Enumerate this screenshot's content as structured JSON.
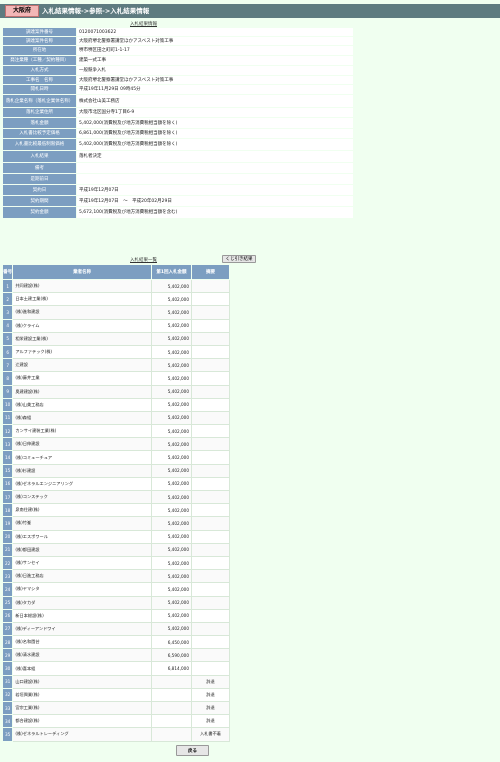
{
  "header": {
    "logo_text": "大阪府",
    "breadcrumb": "入札結果情報->参照->入札結果情報"
  },
  "detail": {
    "caption": "入札結果情報",
    "rows": [
      {
        "label": "調達案件番号",
        "value": "0120071003622"
      },
      {
        "label": "調達案件名称",
        "value": "大阪府堺北警察署講堂ほかアスベスト対策工事"
      },
      {
        "label": "所在地",
        "value": "堺市堺区田之町町1-1-17"
      },
      {
        "label": "発注業種（工種／契約種目）",
        "value": "建築一式工事"
      },
      {
        "label": "入札方式",
        "value": "一般競争入札"
      },
      {
        "label": "工事名　名称",
        "value": "大阪府堺北警察署講堂ほかアスベスト対策工事"
      },
      {
        "label": "開札日時",
        "value": "平成19年11月29日 09時45分"
      },
      {
        "label": "落札企業名称（落札企業体名称）",
        "value": "株式会社山美工務店"
      },
      {
        "label": "落札企業住所",
        "value": "大阪市北区国分寺1丁目6-9"
      },
      {
        "label": "落札金額",
        "value": "5,402,000(消費税及び地方消費税相当額を除く)"
      },
      {
        "label": "入札書比較予定価格",
        "value": "6,861,000(消費税及び地方消費税相当額を除く)"
      },
      {
        "label": "入札書比較最低制限価格",
        "value": "5,402,000(消費税及び地方消費税相当額を除く)"
      },
      {
        "label": "入札結果",
        "value": "落札者決定"
      },
      {
        "label": "備考",
        "value": ""
      },
      {
        "label": "是期前日",
        "value": ""
      },
      {
        "label": "契約日",
        "value": "平成19年12月07日"
      },
      {
        "label": "契約期間",
        "value": "平成19年12月07日　～　平成20年02月29日"
      },
      {
        "label": "契約金額",
        "value": "5,672,100(消費税及び地方消費税相当額を含む)"
      }
    ]
  },
  "results": {
    "caption": "入札結果一覧",
    "lottery_button": "くじ引き結果",
    "columns": [
      "番号",
      "業者名称",
      "第1回入札金額",
      "摘要"
    ],
    "rows": [
      {
        "no": "1",
        "name": "共同建設(株)",
        "amount": "5,402,000",
        "note": ""
      },
      {
        "no": "2",
        "name": "日本土建工業(株)",
        "amount": "5,402,000",
        "note": ""
      },
      {
        "no": "3",
        "name": "(株)進和建設",
        "amount": "5,402,000",
        "note": ""
      },
      {
        "no": "4",
        "name": "(株)クライム",
        "amount": "5,402,000",
        "note": ""
      },
      {
        "no": "5",
        "name": "相栄建設工業(株)",
        "amount": "5,402,000",
        "note": ""
      },
      {
        "no": "6",
        "name": "アルファテック(株)",
        "amount": "5,402,000",
        "note": ""
      },
      {
        "no": "7",
        "name": "辻建設",
        "amount": "5,402,000",
        "note": ""
      },
      {
        "no": "8",
        "name": "(株)藤井工業",
        "amount": "5,402,000",
        "note": ""
      },
      {
        "no": "9",
        "name": "奥建建設(株)",
        "amount": "5,402,000",
        "note": ""
      },
      {
        "no": "10",
        "name": "(株)山美工務店",
        "amount": "5,402,000",
        "note": ""
      },
      {
        "no": "11",
        "name": "(株)森組",
        "amount": "5,402,000",
        "note": ""
      },
      {
        "no": "12",
        "name": "カンサイ建装工業(株)",
        "amount": "5,402,000",
        "note": ""
      },
      {
        "no": "13",
        "name": "(株)日伸建設",
        "amount": "5,402,000",
        "note": ""
      },
      {
        "no": "14",
        "name": "(株)コミューチュア",
        "amount": "5,402,000",
        "note": ""
      },
      {
        "no": "15",
        "name": "(株)杉建設",
        "amount": "5,402,000",
        "note": ""
      },
      {
        "no": "16",
        "name": "(株)ゼネラルエンジニアリング",
        "amount": "5,402,000",
        "note": ""
      },
      {
        "no": "17",
        "name": "(株)コンステック",
        "amount": "5,402,000",
        "note": ""
      },
      {
        "no": "18",
        "name": "泉南住建(株)",
        "amount": "5,402,000",
        "note": ""
      },
      {
        "no": "19",
        "name": "(株)竹峯",
        "amount": "5,402,000",
        "note": ""
      },
      {
        "no": "20",
        "name": "(株)エスポワール",
        "amount": "5,402,000",
        "note": ""
      },
      {
        "no": "21",
        "name": "(株)都田建設",
        "amount": "5,402,000",
        "note": ""
      },
      {
        "no": "22",
        "name": "(株)サンセイ",
        "amount": "5,402,000",
        "note": ""
      },
      {
        "no": "23",
        "name": "(株)日進工務店",
        "amount": "5,402,000",
        "note": ""
      },
      {
        "no": "24",
        "name": "(株)ヤマシタ",
        "amount": "5,402,000",
        "note": ""
      },
      {
        "no": "25",
        "name": "(株)タカダ",
        "amount": "5,402,000",
        "note": ""
      },
      {
        "no": "26",
        "name": "新日本総設(株)",
        "amount": "5,402,000",
        "note": ""
      },
      {
        "no": "27",
        "name": "(株)ディーアンドワイ",
        "amount": "5,402,000",
        "note": ""
      },
      {
        "no": "28",
        "name": "(株)名和園芸",
        "amount": "6,450,000",
        "note": ""
      },
      {
        "no": "29",
        "name": "(株)清水建設",
        "amount": "6,590,000",
        "note": ""
      },
      {
        "no": "30",
        "name": "(株)喜本組",
        "amount": "6,814,000",
        "note": ""
      },
      {
        "no": "31",
        "name": "山口建設(株)",
        "amount": "",
        "note": "辞退"
      },
      {
        "no": "32",
        "name": "若垣興業(株)",
        "amount": "",
        "note": "辞退"
      },
      {
        "no": "33",
        "name": "宮宗工業(株)",
        "amount": "",
        "note": "辞退"
      },
      {
        "no": "34",
        "name": "都合建設(株)",
        "amount": "",
        "note": "辞退"
      },
      {
        "no": "35",
        "name": "(株)ゼネラルトレーディング",
        "amount": "",
        "note": "入札書不着"
      }
    ]
  },
  "footer": {
    "back_button": "戻る"
  }
}
